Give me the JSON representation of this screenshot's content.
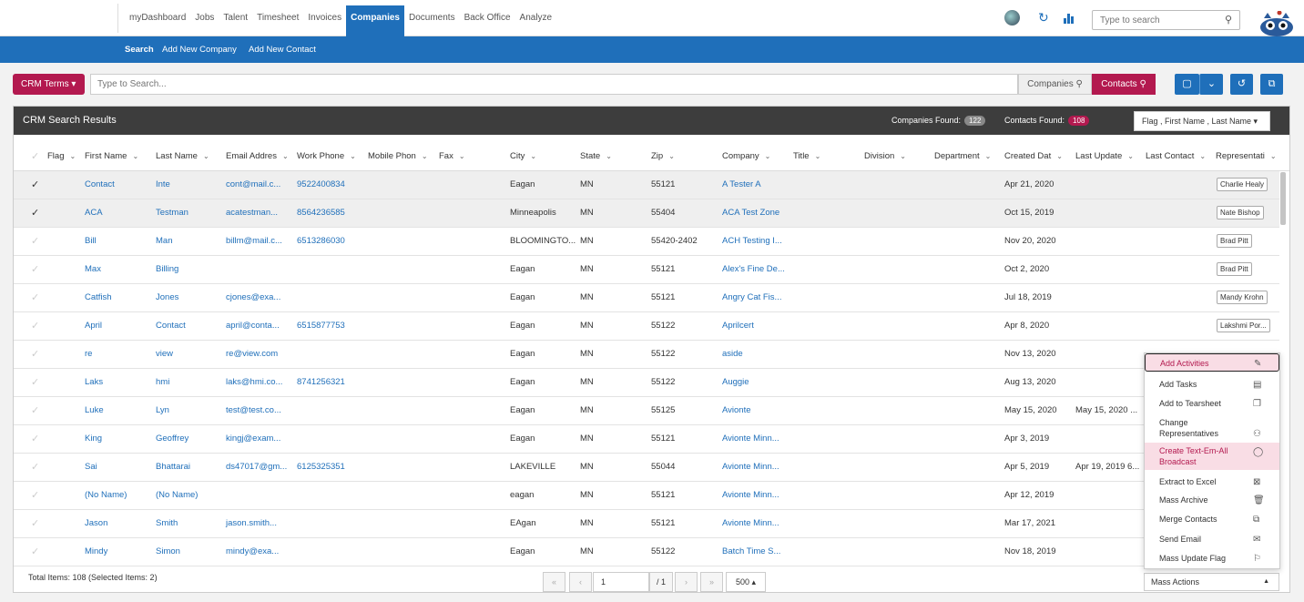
{
  "nav": {
    "tabs": [
      "myDashboard",
      "Jobs",
      "Talent",
      "Timesheet",
      "Invoices",
      "Companies",
      "Documents",
      "Back Office",
      "Analyze"
    ],
    "active": "Companies",
    "search_placeholder": "Type to search"
  },
  "subnav": [
    "Search",
    "Add New Company",
    "Add New Contact"
  ],
  "crm": {
    "terms_label": "CRM Terms ▾",
    "search_placeholder": "Type to Search...",
    "companies_btn": "Companies",
    "contacts_btn": "Contacts"
  },
  "results": {
    "title": "CRM Search Results",
    "companies_found_label": "Companies Found:",
    "companies_found": "122",
    "contacts_found_label": "Contacts Found:",
    "contacts_found": "108",
    "sort_label": "Flag , First Name , Last Name ▾"
  },
  "columns": [
    "Flag",
    "First Name",
    "Last Name",
    "Email Address",
    "Work Phone",
    "Mobile Phone",
    "Fax",
    "City",
    "State",
    "Zip",
    "Company",
    "Title",
    "Division",
    "Department",
    "Created Date",
    "Last Updated",
    "Last Contacted",
    "Representative"
  ],
  "column_display": [
    "Flag",
    "First Name",
    "Last Name",
    "Email Addres",
    "Work Phone",
    "Mobile Phon",
    "Fax",
    "City",
    "State",
    "Zip",
    "Company",
    "Title",
    "Division",
    "Department",
    "Created Dat",
    "Last Update",
    "Last Contact",
    "Representati"
  ],
  "rows": [
    {
      "selected": true,
      "first": "Contact",
      "last": "Inte",
      "email": "cont@mail.c...",
      "phone": "9522400834",
      "city": "Eagan",
      "state": "MN",
      "zip": "55121",
      "company": "A Tester A",
      "created": "Apr 21, 2020",
      "updated": "",
      "rep": "Charlie Healy"
    },
    {
      "selected": true,
      "first": "ACA",
      "last": "Testman",
      "email": "acatestman...",
      "phone": "8564236585",
      "city": "Minneapolis",
      "state": "MN",
      "zip": "55404",
      "company": "ACA Test Zone",
      "created": "Oct 15, 2019",
      "updated": "",
      "rep": "Nate Bishop"
    },
    {
      "selected": false,
      "first": "Bill",
      "last": "Man",
      "email": "billm@mail.c...",
      "phone": "6513286030",
      "city": "BLOOMINGTO...",
      "state": "MN",
      "zip": "55420-2402",
      "company": "ACH Testing I...",
      "created": "Nov 20, 2020",
      "updated": "",
      "rep": "Brad Pitt"
    },
    {
      "selected": false,
      "first": "Max",
      "last": "Billing",
      "email": "",
      "phone": "",
      "city": "Eagan",
      "state": "MN",
      "zip": "55121",
      "company": "Alex's Fine De...",
      "created": "Oct 2, 2020",
      "updated": "",
      "rep": "Brad Pitt"
    },
    {
      "selected": false,
      "first": "Catfish",
      "last": "Jones",
      "email": "cjones@exa...",
      "phone": "",
      "city": "Eagan",
      "state": "MN",
      "zip": "55121",
      "company": "Angry Cat Fis...",
      "created": "Jul 18, 2019",
      "updated": "",
      "rep": "Mandy Krohn"
    },
    {
      "selected": false,
      "first": "April",
      "last": "Contact",
      "email": "april@conta...",
      "phone": "6515877753",
      "city": "Eagan",
      "state": "MN",
      "zip": "55122",
      "company": "Aprilcert",
      "created": "Apr 8, 2020",
      "updated": "",
      "rep": "Lakshmi Por..."
    },
    {
      "selected": false,
      "first": "re",
      "last": "view",
      "email": "re@view.com",
      "phone": "",
      "city": "Eagan",
      "state": "MN",
      "zip": "55122",
      "company": "aside",
      "created": "Nov 13, 2020",
      "updated": "",
      "rep": ""
    },
    {
      "selected": false,
      "first": "Laks",
      "last": "hmi",
      "email": "laks@hmi.co...",
      "phone": "8741256321",
      "city": "Eagan",
      "state": "MN",
      "zip": "55122",
      "company": "Auggie",
      "created": "Aug 13, 2020",
      "updated": "",
      "rep": ""
    },
    {
      "selected": false,
      "first": "Luke",
      "last": "Lyn",
      "email": "test@test.co...",
      "phone": "",
      "city": "Eagan",
      "state": "MN",
      "zip": "55125",
      "company": "Avionte",
      "created": "May 15, 2020",
      "updated": "May 15, 2020 ...",
      "rep": ""
    },
    {
      "selected": false,
      "first": "King",
      "last": "Geoffrey",
      "email": "kingj@exam...",
      "phone": "",
      "city": "Eagan",
      "state": "MN",
      "zip": "55121",
      "company": "Avionte Minn...",
      "created": "Apr 3, 2019",
      "updated": "",
      "rep": ""
    },
    {
      "selected": false,
      "first": "Sai",
      "last": "Bhattarai",
      "email": "ds47017@gm...",
      "phone": "6125325351",
      "city": "LAKEVILLE",
      "state": "MN",
      "zip": "55044",
      "company": "Avionte Minn...",
      "created": "Apr 5, 2019",
      "updated": "Apr 19, 2019 6...",
      "rep": ""
    },
    {
      "selected": false,
      "first": "(No Name)",
      "last": "(No Name)",
      "email": "",
      "phone": "",
      "city": "eagan",
      "state": "MN",
      "zip": "55121",
      "company": "Avionte Minn...",
      "created": "Apr 12, 2019",
      "updated": "",
      "rep": ""
    },
    {
      "selected": false,
      "first": "Jason",
      "last": "Smith",
      "email": "jason.smith...",
      "phone": "",
      "city": "EAgan",
      "state": "MN",
      "zip": "55121",
      "company": "Avionte Minn...",
      "created": "Mar 17, 2021",
      "updated": "",
      "rep": ""
    },
    {
      "selected": false,
      "first": "Mindy",
      "last": "Simon",
      "email": "mindy@exa...",
      "phone": "",
      "city": "Eagan",
      "state": "MN",
      "zip": "55122",
      "company": "Batch Time S...",
      "created": "Nov 18, 2019",
      "updated": "",
      "rep": ""
    }
  ],
  "footer": {
    "total": "Total Items: 108 (Selected Items: 2)",
    "page": "1",
    "of": "/ 1",
    "page_size": "500 ▴",
    "mass_actions": "Mass Actions"
  },
  "mass_menu": [
    {
      "label": "Add Activities",
      "icon": "✎"
    },
    {
      "label": "Add Tasks",
      "icon": "▤"
    },
    {
      "label": "Add to Tearsheet",
      "icon": "❐"
    },
    {
      "label": "Change Representatives",
      "icon": "⚇"
    },
    {
      "label": "Create Text-Em-All Broadcast",
      "icon": "◯"
    },
    {
      "label": "Extract to Excel",
      "icon": "⊠"
    },
    {
      "label": "Mass Archive",
      "icon": "🗑"
    },
    {
      "label": "Merge Contacts",
      "icon": "⧉"
    },
    {
      "label": "Send Email",
      "icon": "✉"
    },
    {
      "label": "Mass Update Flag",
      "icon": "⚐"
    }
  ],
  "colors": {
    "brand_blue": "#1f6fba",
    "brand_pink": "#b3194f",
    "header_dark": "#3d3d3d"
  }
}
